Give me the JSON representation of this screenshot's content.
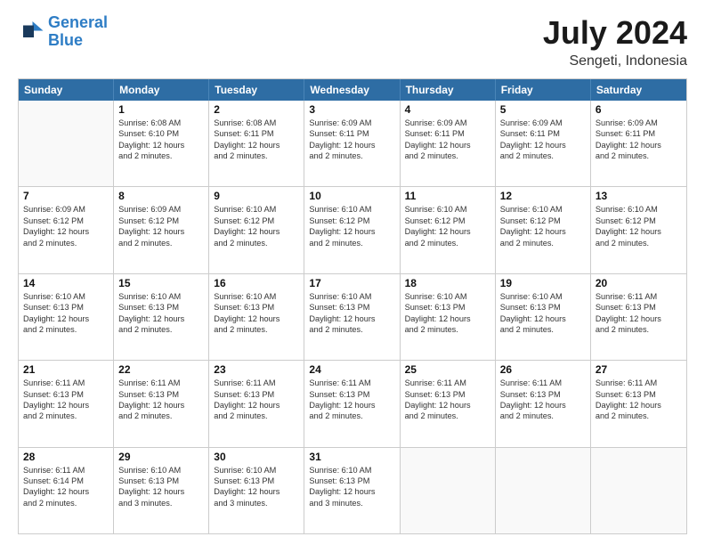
{
  "header": {
    "logo_general": "General",
    "logo_blue": "Blue",
    "title": "July 2024",
    "subtitle": "Sengeti, Indonesia"
  },
  "calendar": {
    "days": [
      "Sunday",
      "Monday",
      "Tuesday",
      "Wednesday",
      "Thursday",
      "Friday",
      "Saturday"
    ],
    "weeks": [
      [
        {
          "day": "",
          "lines": []
        },
        {
          "day": "1",
          "lines": [
            "Sunrise: 6:08 AM",
            "Sunset: 6:10 PM",
            "Daylight: 12 hours",
            "and 2 minutes."
          ]
        },
        {
          "day": "2",
          "lines": [
            "Sunrise: 6:08 AM",
            "Sunset: 6:11 PM",
            "Daylight: 12 hours",
            "and 2 minutes."
          ]
        },
        {
          "day": "3",
          "lines": [
            "Sunrise: 6:09 AM",
            "Sunset: 6:11 PM",
            "Daylight: 12 hours",
            "and 2 minutes."
          ]
        },
        {
          "day": "4",
          "lines": [
            "Sunrise: 6:09 AM",
            "Sunset: 6:11 PM",
            "Daylight: 12 hours",
            "and 2 minutes."
          ]
        },
        {
          "day": "5",
          "lines": [
            "Sunrise: 6:09 AM",
            "Sunset: 6:11 PM",
            "Daylight: 12 hours",
            "and 2 minutes."
          ]
        },
        {
          "day": "6",
          "lines": [
            "Sunrise: 6:09 AM",
            "Sunset: 6:11 PM",
            "Daylight: 12 hours",
            "and 2 minutes."
          ]
        }
      ],
      [
        {
          "day": "7",
          "lines": [
            "Sunrise: 6:09 AM",
            "Sunset: 6:12 PM",
            "Daylight: 12 hours",
            "and 2 minutes."
          ]
        },
        {
          "day": "8",
          "lines": [
            "Sunrise: 6:09 AM",
            "Sunset: 6:12 PM",
            "Daylight: 12 hours",
            "and 2 minutes."
          ]
        },
        {
          "day": "9",
          "lines": [
            "Sunrise: 6:10 AM",
            "Sunset: 6:12 PM",
            "Daylight: 12 hours",
            "and 2 minutes."
          ]
        },
        {
          "day": "10",
          "lines": [
            "Sunrise: 6:10 AM",
            "Sunset: 6:12 PM",
            "Daylight: 12 hours",
            "and 2 minutes."
          ]
        },
        {
          "day": "11",
          "lines": [
            "Sunrise: 6:10 AM",
            "Sunset: 6:12 PM",
            "Daylight: 12 hours",
            "and 2 minutes."
          ]
        },
        {
          "day": "12",
          "lines": [
            "Sunrise: 6:10 AM",
            "Sunset: 6:12 PM",
            "Daylight: 12 hours",
            "and 2 minutes."
          ]
        },
        {
          "day": "13",
          "lines": [
            "Sunrise: 6:10 AM",
            "Sunset: 6:12 PM",
            "Daylight: 12 hours",
            "and 2 minutes."
          ]
        }
      ],
      [
        {
          "day": "14",
          "lines": [
            "Sunrise: 6:10 AM",
            "Sunset: 6:13 PM",
            "Daylight: 12 hours",
            "and 2 minutes."
          ]
        },
        {
          "day": "15",
          "lines": [
            "Sunrise: 6:10 AM",
            "Sunset: 6:13 PM",
            "Daylight: 12 hours",
            "and 2 minutes."
          ]
        },
        {
          "day": "16",
          "lines": [
            "Sunrise: 6:10 AM",
            "Sunset: 6:13 PM",
            "Daylight: 12 hours",
            "and 2 minutes."
          ]
        },
        {
          "day": "17",
          "lines": [
            "Sunrise: 6:10 AM",
            "Sunset: 6:13 PM",
            "Daylight: 12 hours",
            "and 2 minutes."
          ]
        },
        {
          "day": "18",
          "lines": [
            "Sunrise: 6:10 AM",
            "Sunset: 6:13 PM",
            "Daylight: 12 hours",
            "and 2 minutes."
          ]
        },
        {
          "day": "19",
          "lines": [
            "Sunrise: 6:10 AM",
            "Sunset: 6:13 PM",
            "Daylight: 12 hours",
            "and 2 minutes."
          ]
        },
        {
          "day": "20",
          "lines": [
            "Sunrise: 6:11 AM",
            "Sunset: 6:13 PM",
            "Daylight: 12 hours",
            "and 2 minutes."
          ]
        }
      ],
      [
        {
          "day": "21",
          "lines": [
            "Sunrise: 6:11 AM",
            "Sunset: 6:13 PM",
            "Daylight: 12 hours",
            "and 2 minutes."
          ]
        },
        {
          "day": "22",
          "lines": [
            "Sunrise: 6:11 AM",
            "Sunset: 6:13 PM",
            "Daylight: 12 hours",
            "and 2 minutes."
          ]
        },
        {
          "day": "23",
          "lines": [
            "Sunrise: 6:11 AM",
            "Sunset: 6:13 PM",
            "Daylight: 12 hours",
            "and 2 minutes."
          ]
        },
        {
          "day": "24",
          "lines": [
            "Sunrise: 6:11 AM",
            "Sunset: 6:13 PM",
            "Daylight: 12 hours",
            "and 2 minutes."
          ]
        },
        {
          "day": "25",
          "lines": [
            "Sunrise: 6:11 AM",
            "Sunset: 6:13 PM",
            "Daylight: 12 hours",
            "and 2 minutes."
          ]
        },
        {
          "day": "26",
          "lines": [
            "Sunrise: 6:11 AM",
            "Sunset: 6:13 PM",
            "Daylight: 12 hours",
            "and 2 minutes."
          ]
        },
        {
          "day": "27",
          "lines": [
            "Sunrise: 6:11 AM",
            "Sunset: 6:13 PM",
            "Daylight: 12 hours",
            "and 2 minutes."
          ]
        }
      ],
      [
        {
          "day": "28",
          "lines": [
            "Sunrise: 6:11 AM",
            "Sunset: 6:14 PM",
            "Daylight: 12 hours",
            "and 2 minutes."
          ]
        },
        {
          "day": "29",
          "lines": [
            "Sunrise: 6:10 AM",
            "Sunset: 6:13 PM",
            "Daylight: 12 hours",
            "and 3 minutes."
          ]
        },
        {
          "day": "30",
          "lines": [
            "Sunrise: 6:10 AM",
            "Sunset: 6:13 PM",
            "Daylight: 12 hours",
            "and 3 minutes."
          ]
        },
        {
          "day": "31",
          "lines": [
            "Sunrise: 6:10 AM",
            "Sunset: 6:13 PM",
            "Daylight: 12 hours",
            "and 3 minutes."
          ]
        },
        {
          "day": "",
          "lines": []
        },
        {
          "day": "",
          "lines": []
        },
        {
          "day": "",
          "lines": []
        }
      ]
    ]
  }
}
